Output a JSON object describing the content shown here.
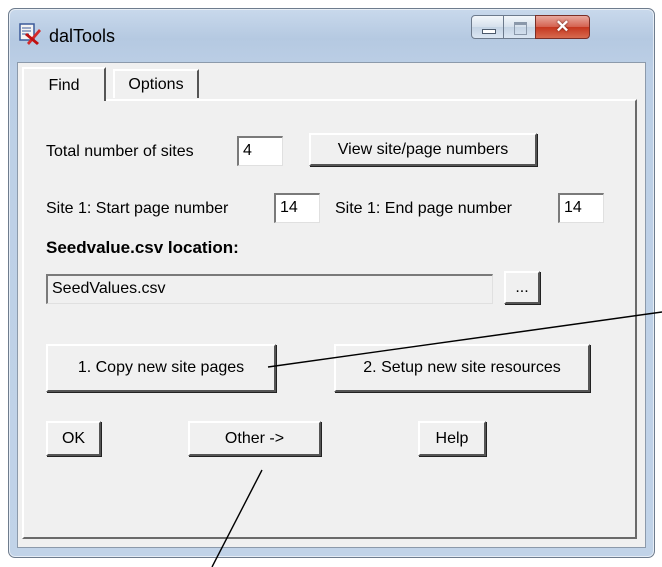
{
  "window": {
    "title": "dalTools"
  },
  "tabs": [
    {
      "label": "Find",
      "active": true
    },
    {
      "label": "Options",
      "active": false
    }
  ],
  "find": {
    "total_sites_label": "Total number of sites",
    "total_sites_value": "4",
    "view_numbers_button": "View site/page numbers",
    "start_page_label": "Site 1: Start page number",
    "start_page_value": "14",
    "end_page_label": "Site 1: End page number",
    "end_page_value": "14",
    "seed_location_label": "Seedvalue.csv location:",
    "seed_location_value": "SeedValues.csv",
    "browse_button": "...",
    "copy_pages_button": "1. Copy new site pages",
    "setup_resources_button": "2. Setup new site resources",
    "ok_button": "OK",
    "other_button": "Other ->",
    "help_button": "Help"
  },
  "colors": {
    "frame": "#c1d3e8",
    "client_bg": "#f0f0f0",
    "close_button": "#c5361f"
  }
}
